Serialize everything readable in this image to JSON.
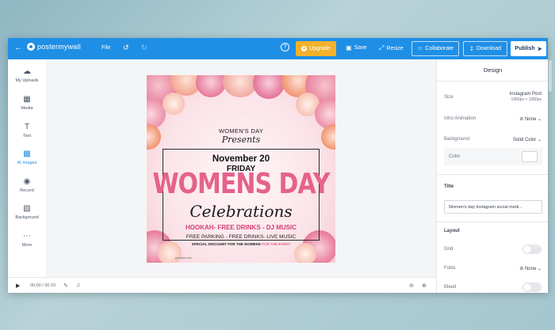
{
  "topbar": {
    "brand": "postermywall",
    "file_label": "File",
    "upgrade_label": "Upgrade",
    "save_label": "Save",
    "resize_label": "Resize",
    "collaborate_label": "Collaborate",
    "download_label": "Download",
    "publish_label": "Publish"
  },
  "sidebar": {
    "items": [
      {
        "label": "My Uploads",
        "icon": "upload-icon"
      },
      {
        "label": "Media",
        "icon": "media-icon"
      },
      {
        "label": "Text",
        "icon": "text-icon"
      },
      {
        "label": "AI Images",
        "icon": "ai-images-icon"
      },
      {
        "label": "Record",
        "icon": "record-icon"
      },
      {
        "label": "Background",
        "icon": "background-icon"
      },
      {
        "label": "More",
        "icon": "more-icon"
      }
    ]
  },
  "poster": {
    "womens_day_small": "WOMEN'S DAY",
    "presents": "Presents",
    "date": "November 20",
    "day": "FRIDAY",
    "big_title": "WOMENS DAY",
    "celebrations": "Celebrations",
    "hookah_line": "HOOKAH- FREE DRINKS - DJ MUSIC",
    "parking_line": "FREE PARKING - FREE DRINKS- LIVE MUSIC",
    "discount_line": "SPECIAL DISCOUNT FOR THE WOMENS",
    "discount_accent": "FOR THE EVENT",
    "url": "yourweb.com"
  },
  "timeline": {
    "time": "00:00 / 00:10"
  },
  "panel": {
    "title": "Design",
    "size_label": "Size",
    "size_value": "Instagram Post",
    "size_dims": "1080px × 1080px",
    "intro_label": "Intro Animation",
    "intro_value": "None",
    "background_label": "Background",
    "background_value": "Solid Color",
    "color_label": "Color",
    "title_label": "Title",
    "title_value": "Women's day Instagram social medi...",
    "layout_label": "Layout",
    "grid_label": "Grid",
    "folds_label": "Folds",
    "folds_value": "None",
    "bleed_label": "Bleed"
  },
  "colors": {
    "brand_blue": "#1f8fe6",
    "upgrade_orange": "#f3b12b",
    "poster_pink": "#e5628c"
  }
}
